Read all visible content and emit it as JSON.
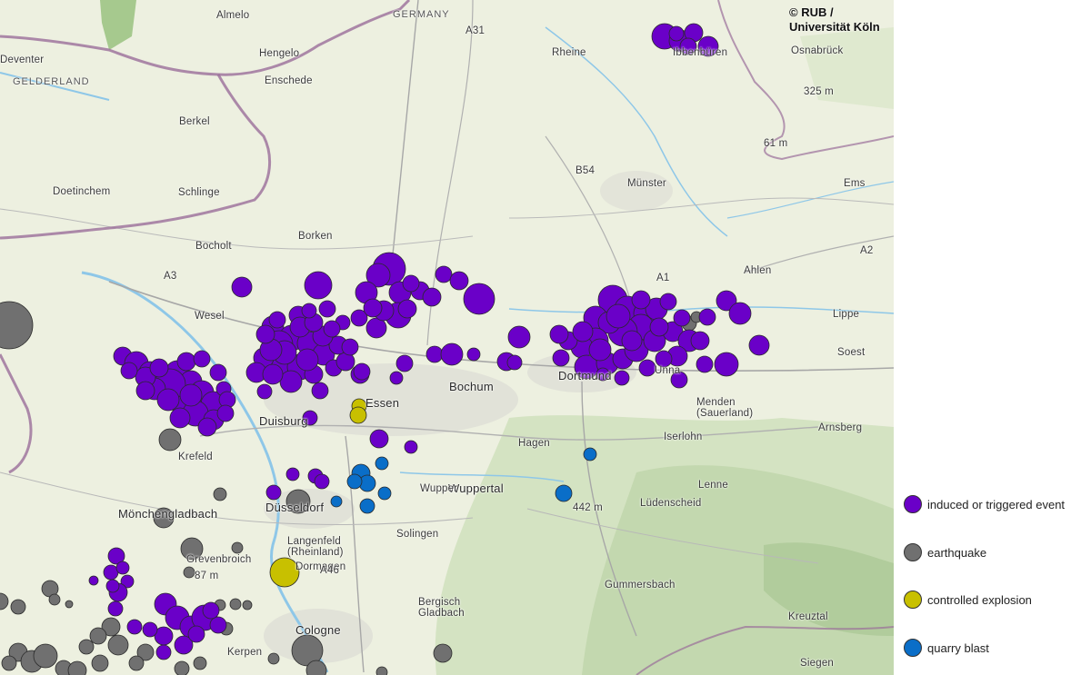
{
  "copyright": {
    "line1": "© RUB /",
    "line2": "Universität Köln"
  },
  "colors": {
    "induced": "#6a00c8",
    "earthquake": "#707070",
    "explosion": "#c8c000",
    "quarry": "#0a6ec8",
    "border": "#9a6e9a"
  },
  "places": [
    {
      "name": "Almelo"
    },
    {
      "name": "Deventer"
    },
    {
      "name": "Hengelo"
    },
    {
      "name": "Enschede"
    },
    {
      "name": "GELDERLAND",
      "cls": "region"
    },
    {
      "name": "Doetinchem"
    },
    {
      "name": "Bocholt"
    },
    {
      "name": "Borken"
    },
    {
      "name": "Wesel"
    },
    {
      "name": "Krefeld"
    },
    {
      "name": "Duisburg",
      "cls": "big"
    },
    {
      "name": "Essen",
      "cls": "big"
    },
    {
      "name": "Bochum",
      "cls": "big"
    },
    {
      "name": "Dortmund",
      "cls": "big"
    },
    {
      "name": "Hagen"
    },
    {
      "name": "Wuppertal",
      "cls": "big"
    },
    {
      "name": "Düsseldorf",
      "cls": "big"
    },
    {
      "name": "Mönchengladbach",
      "cls": "big"
    },
    {
      "name": "Solingen"
    },
    {
      "name": "Langenfeld\n(Rheinland)"
    },
    {
      "name": "Grevenbroich"
    },
    {
      "name": "Dormagen"
    },
    {
      "name": "Cologne",
      "cls": "big"
    },
    {
      "name": "Kerpen"
    },
    {
      "name": "Bergisch\nGladbach"
    },
    {
      "name": "Gummersbach"
    },
    {
      "name": "Lüdenscheid"
    },
    {
      "name": "Iserlohn"
    },
    {
      "name": "Menden\n(Sauerland)"
    },
    {
      "name": "Arnsberg"
    },
    {
      "name": "Soest"
    },
    {
      "name": "Ahlen"
    },
    {
      "name": "Münster"
    },
    {
      "name": "Rheine"
    },
    {
      "name": "Ibbenbüren"
    },
    {
      "name": "Osnabrück"
    },
    {
      "name": "Unna"
    },
    {
      "name": "Kreuztal"
    },
    {
      "name": "Siegen"
    },
    {
      "name": "GERMANY",
      "cls": "region"
    },
    {
      "name": "Lippe"
    },
    {
      "name": "Ems"
    },
    {
      "name": "Wupper"
    },
    {
      "name": "Berkel"
    },
    {
      "name": "Schlinge"
    },
    {
      "name": "Lenne"
    },
    {
      "name": "325 m"
    },
    {
      "name": "61 m"
    },
    {
      "name": "87 m"
    },
    {
      "name": "442 m"
    },
    {
      "name": "A3"
    },
    {
      "name": "A31"
    },
    {
      "name": "A1"
    },
    {
      "name": "A2"
    },
    {
      "name": "A46"
    },
    {
      "name": "B54"
    }
  ],
  "legend": [
    {
      "key": "induced",
      "label": "induced or triggered event"
    },
    {
      "key": "earthquake",
      "label": "earthquake"
    },
    {
      "key": "explosion",
      "label": "controlled explosion"
    },
    {
      "key": "quarry",
      "label": "quarry blast"
    }
  ],
  "events": {
    "induced": [
      [
        731,
        40,
        14
      ],
      [
        748,
        45,
        12
      ],
      [
        763,
        36,
        10
      ],
      [
        779,
        51,
        11
      ],
      [
        757,
        51,
        9
      ],
      [
        744,
        37,
        8
      ],
      [
        266,
        316,
        11
      ],
      [
        350,
        314,
        15
      ],
      [
        428,
        296,
        18
      ],
      [
        416,
        303,
        13
      ],
      [
        440,
        322,
        12
      ],
      [
        462,
        320,
        10
      ],
      [
        488,
        302,
        9
      ],
      [
        505,
        309,
        10
      ],
      [
        527,
        329,
        17
      ],
      [
        403,
        322,
        12
      ],
      [
        438,
        347,
        14
      ],
      [
        414,
        361,
        11
      ],
      [
        475,
        327,
        10
      ],
      [
        452,
        312,
        9
      ],
      [
        422,
        342,
        11
      ],
      [
        448,
        340,
        10
      ],
      [
        395,
        350,
        9
      ],
      [
        410,
        339,
        10
      ],
      [
        328,
        347,
        10
      ],
      [
        300,
        360,
        12
      ],
      [
        360,
        340,
        9
      ],
      [
        377,
        355,
        8
      ],
      [
        321,
        372,
        14
      ],
      [
        307,
        379,
        15
      ],
      [
        340,
        378,
        13
      ],
      [
        356,
        390,
        12
      ],
      [
        310,
        400,
        13
      ],
      [
        330,
        404,
        14
      ],
      [
        290,
        394,
        11
      ],
      [
        282,
        410,
        11
      ],
      [
        345,
        412,
        10
      ],
      [
        367,
        405,
        9
      ],
      [
        380,
        398,
        10
      ],
      [
        396,
        412,
        10
      ],
      [
        352,
        430,
        9
      ],
      [
        291,
        431,
        8
      ],
      [
        320,
        420,
        12
      ],
      [
        300,
        412,
        11
      ],
      [
        372,
        380,
        10
      ],
      [
        338,
        396,
        12
      ],
      [
        313,
        388,
        13
      ],
      [
        298,
        385,
        12
      ],
      [
        355,
        370,
        11
      ],
      [
        385,
        382,
        9
      ],
      [
        330,
        360,
        11
      ],
      [
        345,
        355,
        10
      ],
      [
        365,
        362,
        9
      ],
      [
        292,
        368,
        10
      ],
      [
        305,
        352,
        9
      ],
      [
        340,
        342,
        8
      ],
      [
        135,
        392,
        10
      ],
      [
        150,
        400,
        13
      ],
      [
        165,
        410,
        12
      ],
      [
        180,
        420,
        14
      ],
      [
        195,
        410,
        13
      ],
      [
        210,
        420,
        12
      ],
      [
        222,
        432,
        13
      ],
      [
        235,
        445,
        14
      ],
      [
        200,
        445,
        12
      ],
      [
        215,
        455,
        14
      ],
      [
        235,
        462,
        11
      ],
      [
        187,
        423,
        17
      ],
      [
        170,
        428,
        12
      ],
      [
        160,
        415,
        11
      ],
      [
        205,
        398,
        10
      ],
      [
        222,
        395,
        9
      ],
      [
        240,
        410,
        9
      ],
      [
        246,
        428,
        8
      ],
      [
        228,
        470,
        10
      ],
      [
        210,
        435,
        12
      ],
      [
        185,
        440,
        12
      ],
      [
        160,
        430,
        10
      ],
      [
        250,
        440,
        9
      ],
      [
        198,
        460,
        11
      ],
      [
        248,
        455,
        9
      ],
      [
        175,
        405,
        10
      ],
      [
        142,
        408,
        9
      ],
      [
        445,
        400,
        9
      ],
      [
        478,
        390,
        9
      ],
      [
        497,
        390,
        12
      ],
      [
        521,
        390,
        7
      ],
      [
        557,
        398,
        10
      ],
      [
        571,
        371,
        12
      ],
      [
        566,
        399,
        8
      ],
      [
        436,
        416,
        7
      ],
      [
        398,
        409,
        9
      ],
      [
        341,
        460,
        8
      ],
      [
        674,
        330,
        16
      ],
      [
        655,
        350,
        13
      ],
      [
        690,
        340,
        14
      ],
      [
        710,
        345,
        13
      ],
      [
        722,
        340,
        12
      ],
      [
        705,
        360,
        14
      ],
      [
        685,
        365,
        16
      ],
      [
        670,
        355,
        12
      ],
      [
        655,
        375,
        14
      ],
      [
        640,
        382,
        12
      ],
      [
        625,
        375,
        10
      ],
      [
        617,
        394,
        9
      ],
      [
        645,
        404,
        13
      ],
      [
        668,
        400,
        12
      ],
      [
        685,
        395,
        11
      ],
      [
        700,
        385,
        13
      ],
      [
        720,
        375,
        12
      ],
      [
        740,
        365,
        11
      ],
      [
        758,
        375,
        12
      ],
      [
        770,
        375,
        10
      ],
      [
        745,
        392,
        11
      ],
      [
        730,
        395,
        9
      ],
      [
        712,
        405,
        9
      ],
      [
        799,
        331,
        11
      ],
      [
        814,
        345,
        12
      ],
      [
        778,
        349,
        9
      ],
      [
        799,
        401,
        13
      ],
      [
        835,
        380,
        11
      ],
      [
        775,
        401,
        9
      ],
      [
        747,
        418,
        9
      ],
      [
        684,
        416,
        8
      ],
      [
        663,
        412,
        7
      ],
      [
        641,
        365,
        11
      ],
      [
        615,
        368,
        10
      ],
      [
        660,
        385,
        12
      ],
      [
        695,
        375,
        11
      ],
      [
        725,
        360,
        10
      ],
      [
        750,
        350,
        9
      ],
      [
        705,
        330,
        10
      ],
      [
        735,
        332,
        9
      ],
      [
        680,
        348,
        13
      ],
      [
        417,
        483,
        10
      ],
      [
        452,
        492,
        7
      ],
      [
        322,
        522,
        7
      ],
      [
        347,
        524,
        8
      ],
      [
        354,
        530,
        8
      ],
      [
        301,
        542,
        8
      ],
      [
        128,
        612,
        9
      ],
      [
        122,
        630,
        8
      ],
      [
        103,
        639,
        5
      ],
      [
        135,
        625,
        7
      ],
      [
        140,
        640,
        7
      ],
      [
        130,
        652,
        10
      ],
      [
        127,
        670,
        8
      ],
      [
        182,
        665,
        12
      ],
      [
        195,
        680,
        13
      ],
      [
        210,
        690,
        12
      ],
      [
        225,
        680,
        14
      ],
      [
        240,
        688,
        9
      ],
      [
        180,
        700,
        10
      ],
      [
        165,
        693,
        8
      ],
      [
        148,
        690,
        8
      ],
      [
        202,
        710,
        10
      ],
      [
        180,
        718,
        8
      ],
      [
        216,
        698,
        9
      ],
      [
        232,
        672,
        9
      ],
      [
        124,
        645,
        7
      ]
    ],
    "earthquake": [
      [
        10,
        358,
        26
      ],
      [
        758,
        356,
        8
      ],
      [
        748,
        353,
        6
      ],
      [
        766,
        349,
        6
      ],
      [
        187,
        484,
        12
      ],
      [
        242,
        544,
        7
      ],
      [
        328,
        552,
        13
      ],
      [
        180,
        570,
        11
      ],
      [
        211,
        604,
        12
      ],
      [
        261,
        603,
        6
      ],
      [
        208,
        630,
        6
      ],
      [
        0,
        662,
        9
      ],
      [
        20,
        668,
        8
      ],
      [
        55,
        648,
        9
      ],
      [
        60,
        660,
        6
      ],
      [
        76,
        665,
        4
      ],
      [
        242,
        666,
        6
      ],
      [
        259,
        665,
        6
      ],
      [
        272,
        666,
        5
      ],
      [
        249,
        692,
        7
      ],
      [
        122,
        690,
        10
      ],
      [
        108,
        700,
        9
      ],
      [
        95,
        712,
        8
      ],
      [
        130,
        710,
        11
      ],
      [
        160,
        718,
        9
      ],
      [
        20,
        718,
        10
      ],
      [
        35,
        728,
        12
      ],
      [
        50,
        722,
        13
      ],
      [
        70,
        736,
        9
      ],
      [
        85,
        738,
        10
      ],
      [
        10,
        730,
        8
      ],
      [
        110,
        730,
        9
      ],
      [
        150,
        730,
        8
      ],
      [
        200,
        736,
        8
      ],
      [
        220,
        730,
        7
      ],
      [
        338,
        716,
        17
      ],
      [
        348,
        738,
        11
      ],
      [
        487,
        719,
        10
      ],
      [
        301,
        725,
        6
      ],
      [
        420,
        740,
        6
      ]
    ],
    "explosion": [
      [
        395,
        447,
        8
      ],
      [
        394,
        457,
        9
      ],
      [
        664,
        407,
        5
      ],
      [
        313,
        630,
        16
      ]
    ],
    "quarry": [
      [
        397,
        521,
        10
      ],
      [
        404,
        532,
        9
      ],
      [
        390,
        530,
        8
      ],
      [
        420,
        510,
        7
      ],
      [
        423,
        543,
        7
      ],
      [
        404,
        557,
        8
      ],
      [
        370,
        552,
        6
      ],
      [
        620,
        543,
        9
      ],
      [
        649,
        500,
        7
      ]
    ]
  }
}
